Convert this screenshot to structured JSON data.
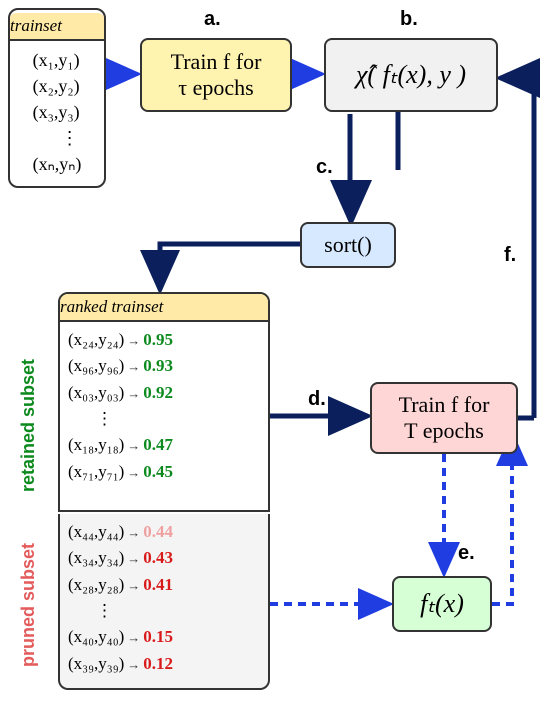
{
  "chart_data": {
    "type": "diagram",
    "title": "",
    "nodes": [
      {
        "id": "trainset",
        "label": "trainset",
        "content": [
          "(x₁,y₁)",
          "(x₂,y₂)",
          "(x₃,y₃)",
          "…",
          "(xₙ,yₙ)"
        ]
      },
      {
        "id": "train_tau",
        "label": "Train f for τ epochs"
      },
      {
        "id": "chi",
        "label": "χ̂(f_t(x), y)"
      },
      {
        "id": "sort",
        "label": "sort()"
      },
      {
        "id": "ranked_trainset",
        "label": "ranked trainset",
        "retained": [
          {
            "sample": "(x₂₄,y₂₄)",
            "score": 0.95
          },
          {
            "sample": "(x₉₆,y₉₆)",
            "score": 0.93
          },
          {
            "sample": "(x₀₃,y₀₃)",
            "score": 0.92
          },
          {
            "sample": "(x₁₈,y₁₈)",
            "score": 0.47
          },
          {
            "sample": "(x₇₁,y₇₁)",
            "score": 0.45
          }
        ],
        "pruned": [
          {
            "sample": "(x₄₄,y₄₄)",
            "score": 0.44
          },
          {
            "sample": "(x₃₄,y₃₄)",
            "score": 0.43
          },
          {
            "sample": "(x₂₈,y₂₈)",
            "score": 0.41
          },
          {
            "sample": "(x₄₀,y₄₀)",
            "score": 0.15
          },
          {
            "sample": "(x₃₉,y₃₉)",
            "score": 0.12
          }
        ]
      },
      {
        "id": "train_T",
        "label": "Train f for T epochs"
      },
      {
        "id": "ft",
        "label": "f_t(x)"
      }
    ],
    "edges": [
      {
        "from": "trainset",
        "to": "train_tau",
        "style": "dashed",
        "label": "a."
      },
      {
        "from": "train_tau",
        "to": "chi",
        "style": "dashed",
        "label": "b."
      },
      {
        "from": "chi",
        "to": "sort",
        "style": "solid",
        "label": "c."
      },
      {
        "from": "sort",
        "to": "ranked_trainset",
        "style": "solid",
        "label": ""
      },
      {
        "from": "ranked_trainset.retained",
        "to": "train_T",
        "style": "solid",
        "label": "d."
      },
      {
        "from": "train_T",
        "to": "ft",
        "style": "dashed",
        "label": "e."
      },
      {
        "from": "ranked_trainset.pruned",
        "to": "ft",
        "style": "dashed",
        "label": ""
      },
      {
        "from": "ft",
        "to": "chi",
        "style": "dashed",
        "label": "f."
      },
      {
        "from": "train_T",
        "to": "chi",
        "style": "solid",
        "label": "f."
      }
    ]
  },
  "trainset": {
    "header": "trainset",
    "rows": [
      "(x₁,y₁)",
      "(x₂,y₂)",
      "(x₃,y₃)",
      "⋮",
      "(xₙ,yₙ)"
    ]
  },
  "train_tau": {
    "line1": "Train f for",
    "line2": "τ epochs"
  },
  "chi": {
    "expr": "χ̂( fₜ(x), y )"
  },
  "sort": {
    "label": "sort()"
  },
  "ranked": {
    "header": "ranked trainset",
    "retained_label": "retained subset",
    "pruned_label": "pruned subset",
    "retained": [
      {
        "pair": "(x₂₄,y₂₄)",
        "score": "0.95"
      },
      {
        "pair": "(x₉₆,y₉₆)",
        "score": "0.93"
      },
      {
        "pair": "(x₀₃,y₀₃)",
        "score": "0.92"
      },
      {
        "pair": "⋮",
        "score": ""
      },
      {
        "pair": "(x₁₈,y₁₈)",
        "score": "0.47"
      },
      {
        "pair": "(x₇₁,y₇₁)",
        "score": "0.45"
      }
    ],
    "pruned": [
      {
        "pair": "(x₄₄,y₄₄)",
        "score": "0.44"
      },
      {
        "pair": "(x₃₄,y₃₄)",
        "score": "0.43"
      },
      {
        "pair": "(x₂₈,y₂₈)",
        "score": "0.41"
      },
      {
        "pair": "⋮",
        "score": ""
      },
      {
        "pair": "(x₄₀,y₄₀)",
        "score": "0.15"
      },
      {
        "pair": "(x₃₉,y₃₉)",
        "score": "0.12"
      }
    ]
  },
  "train_T": {
    "line1": "Train f for",
    "line2": "T epochs"
  },
  "ft": {
    "expr": "fₜ(x)"
  },
  "steps": {
    "a": "a.",
    "b": "b.",
    "c": "c.",
    "d": "d.",
    "e": "e.",
    "f": "f."
  }
}
